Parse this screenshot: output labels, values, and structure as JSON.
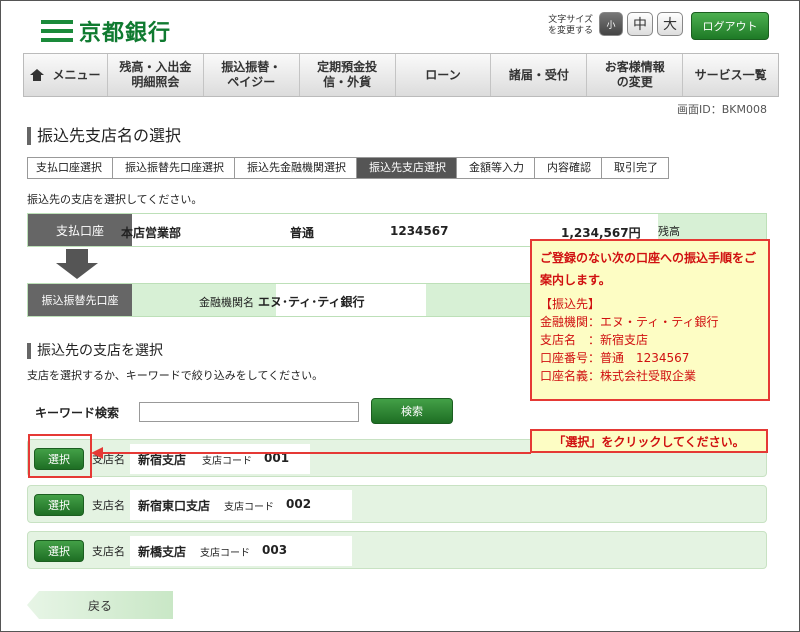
{
  "header": {
    "bank_name": "京都銀行",
    "font_size_label": "文字サイズを変更する",
    "font_sizes": [
      "小",
      "中",
      "大"
    ],
    "logout_label": "ログアウト"
  },
  "nav": {
    "items": [
      "メニュー",
      "残高・入出金明細照会",
      "振込振替・ペイジー",
      "定期預金投信・外貨",
      "ローン",
      "諸届・受付",
      "お客様情報の変更",
      "サービス一覧"
    ]
  },
  "screen_id": "画面ID：BKM008",
  "page_title": "振込先支店名の選択",
  "steps": [
    "支払口座選択",
    "振込振替先口座選択",
    "振込先金融機関選択",
    "振込先支店選択",
    "金額等入力",
    "内容確認",
    "取引完了"
  ],
  "active_step": 3,
  "instruction": "振込先の支店を選択してください。",
  "payment_account": {
    "label": "支払口座",
    "branch": "本店営業部",
    "type": "普通",
    "number": "1234567",
    "balance": "1,234,567円",
    "balance_label": "残高"
  },
  "destination": {
    "label": "振込振替先口座",
    "institution_label": "金融機関名",
    "institution_name": "エヌ･ティ･ティ銀行"
  },
  "note": {
    "heading": "ご登録のない次の口座への振込手順をご案内します。",
    "lines": [
      "【振込先】",
      "金融機関：エヌ・ティ・ティ銀行",
      "支店名　：新宿支店",
      "口座番号：普通　1234567",
      "口座名義：株式会社受取企業"
    ]
  },
  "branch_section": {
    "title": "振込先の支店を選択",
    "description": "支店を選択するか、キーワードで絞り込みをしてください。",
    "keyword_label": "キーワード検索",
    "keyword_value": "",
    "search_label": "検索"
  },
  "callout": "「選択」をクリックしてください。",
  "branches": [
    {
      "select_label": "選択",
      "name_label": "支店名",
      "name": "新宿支店",
      "code_label": "支店コード",
      "code": "001"
    },
    {
      "select_label": "選択",
      "name_label": "支店名",
      "name": "新宿東口支店",
      "code_label": "支店コード",
      "code": "002"
    },
    {
      "select_label": "選択",
      "name_label": "支店名",
      "name": "新橋支店",
      "code_label": "支店コード",
      "code": "003"
    }
  ],
  "back_label": "戻る"
}
